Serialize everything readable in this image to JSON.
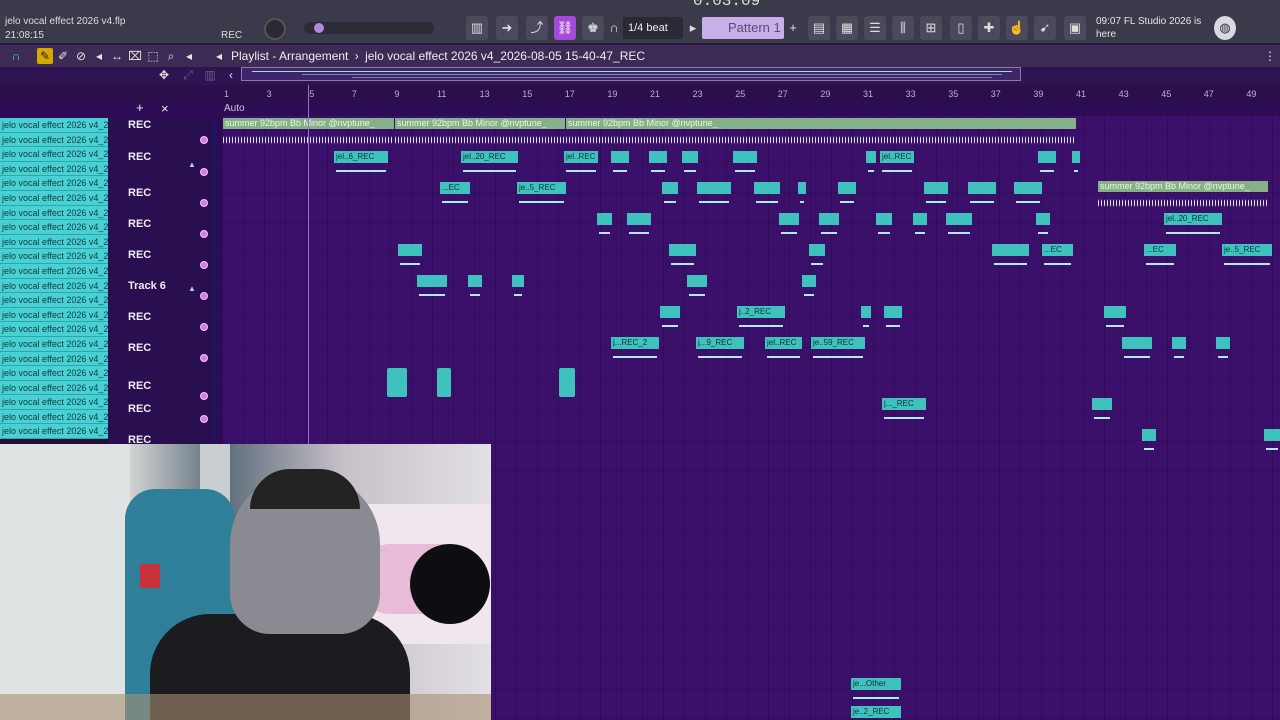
{
  "project": {
    "file_name": "jelo vocal effect 2026 v4.flp",
    "elapsed": "21:08:15",
    "rec_label": "REC",
    "song_time": "0:03:09"
  },
  "toolbar": {
    "snap": "1/4 beat",
    "pattern": "Pattern 1",
    "hint_time": "09:07",
    "hint_text": "FL Studio 2026 is here"
  },
  "playlist": {
    "title": "Playlist - Arrangement",
    "arrangement": "jelo vocal effect 2026 v4_2026-08-05 15-40-47_REC",
    "auto_label": "Auto",
    "bars": [
      "1",
      "3",
      "5",
      "7",
      "9",
      "11",
      "13",
      "15",
      "17",
      "19",
      "21",
      "23",
      "25",
      "27",
      "29",
      "31",
      "33",
      "35",
      "37",
      "39",
      "41",
      "43",
      "45",
      "47",
      "49"
    ]
  },
  "browser": {
    "items": [
      "jelo vocal effect 2026 v4_2...",
      "jelo vocal effect 2026 v4_2...",
      "jelo vocal effect 2026 v4_2...",
      "jelo vocal effect 2026 v4_2...",
      "jelo vocal effect 2026 v4_2...",
      "jelo vocal effect 2026 v4_2...",
      "jelo vocal effect 2026 v4_2...",
      "jelo vocal effect 2026 v4_2...",
      "jelo vocal effect 2026 v4_2...",
      "jelo vocal effect 2026 v4_2...",
      "jelo vocal effect 2026 v4_2...",
      "jelo vocal effect 2026 v4_2...",
      "jelo vocal effect 2026 v4_2...",
      "jelo vocal effect 2026 v4_2...",
      "jelo vocal effect 2026 v4_2...",
      "jelo vocal effect 2026 v4_2...",
      "jelo vocal effect 2026 v4_2...",
      "jelo vocal effect 2026 v4_2...",
      "jelo vocal effect 2026 v4_2...",
      "jelo vocal effect 2026 v4_2...",
      "jelo vocal effect 2026 v4_2...",
      "jelo vocal effect 2026 v4_2..."
    ]
  },
  "tracks": [
    {
      "name": "REC"
    },
    {
      "name": "REC"
    },
    {
      "name": "REC"
    },
    {
      "name": "REC"
    },
    {
      "name": "REC"
    },
    {
      "name": "Track 6"
    },
    {
      "name": "REC"
    },
    {
      "name": "REC"
    },
    {
      "name": "REC"
    },
    {
      "name": "REC"
    },
    {
      "name": "REC"
    }
  ],
  "clips": {
    "beat": "summer 92bpm Bb Minor @nvptune_",
    "c1": "jel..6_REC",
    "c2": "jel..20_REC",
    "c3": "jel..REC",
    "c4": "jel..REC",
    "c5": "je..5_REC",
    "c6": "jel..20_REC",
    "c7": "je..5_REC",
    "c8": "...EC",
    "c9": "j..2_REC",
    "c10": "j...REC_2",
    "c11": "j...9_REC",
    "c12": "jel..REC",
    "c13": "je..59_REC",
    "c14": "j..._REC",
    "c15": "je...Other",
    "c16": "je..2_REC",
    "c17": "...EC",
    "c18": "...EC"
  }
}
